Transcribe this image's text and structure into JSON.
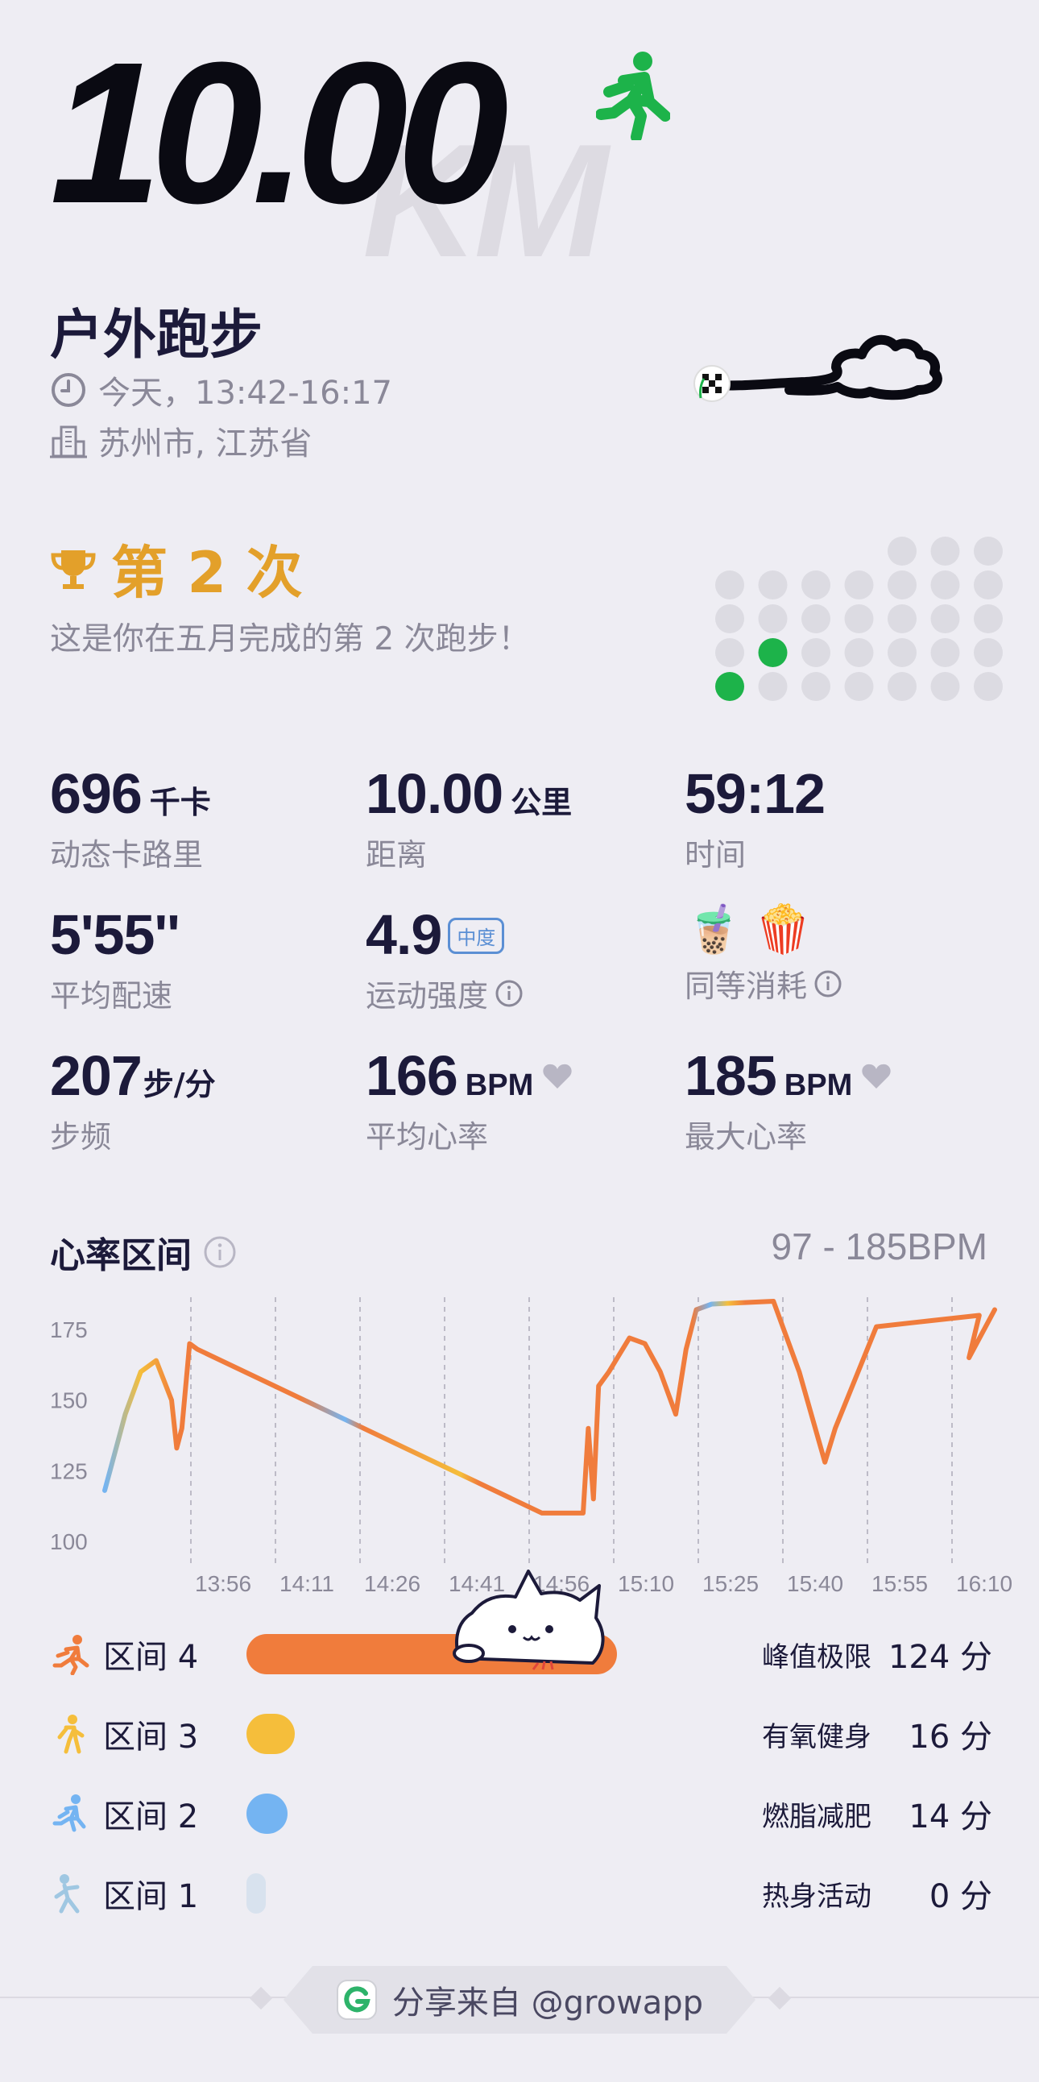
{
  "hero": {
    "distance": "10.00",
    "unit_watermark": "KM"
  },
  "activity": {
    "title": "户外跑步",
    "time": "今天，13:42-16:17",
    "location": "苏州市, 江苏省"
  },
  "achievement": {
    "title": "第 2 次",
    "description": "这是你在五月完成的第 2 次跑步！",
    "highlight_color": "#1db34a",
    "inactive_color": "#dcdbe2"
  },
  "stats": [
    {
      "value": "696",
      "unit": "千卡",
      "label": "动态卡路里"
    },
    {
      "value": "10.00",
      "unit": "公里",
      "label": "距离"
    },
    {
      "value": "59:12",
      "unit": "",
      "label": "时间"
    },
    {
      "value": "5'55''",
      "unit": "",
      "label": "平均配速"
    },
    {
      "value": "4.9",
      "unit": "",
      "badge": "中度",
      "label": "运动强度"
    },
    {
      "value": "🧋 🍿",
      "unit": "",
      "label": "同等消耗"
    },
    {
      "value": "207",
      "unit": "步/分",
      "label": "步频"
    },
    {
      "value": "166",
      "unit": "BPM",
      "label": "平均心率"
    },
    {
      "value": "185",
      "unit": "BPM",
      "label": "最大心率"
    }
  ],
  "heart_rate": {
    "title": "心率区间",
    "range": "97 - 185BPM",
    "y_ticks": [
      "175",
      "150",
      "125",
      "100"
    ],
    "x_ticks": [
      "13:56",
      "14:11",
      "14:26",
      "14:41",
      "14:56",
      "15:10",
      "15:25",
      "15:40",
      "15:55",
      "16:10"
    ]
  },
  "chart_data": {
    "type": "line",
    "title": "心率区间",
    "xlabel": "",
    "ylabel": "",
    "y_ticks": [
      175,
      150,
      125,
      100
    ],
    "ylim": [
      98,
      185
    ],
    "x_ticks": [
      "13:56",
      "14:11",
      "14:26",
      "14:41",
      "14:56",
      "15:10",
      "15:25",
      "15:40",
      "15:55",
      "16:10"
    ],
    "x_minutes": [
      0,
      4,
      7,
      10,
      13,
      14,
      15,
      16.5,
      18,
      85,
      93,
      94,
      95,
      96,
      98,
      100,
      102,
      105,
      108,
      111,
      113,
      115,
      118,
      130,
      135,
      140,
      142,
      150,
      160,
      170,
      168,
      173
    ],
    "series": [
      {
        "values": [
          118,
          145,
          160,
          164,
          150,
          133,
          140,
          170,
          168,
          110,
          110,
          140,
          115,
          155,
          160,
          166,
          172,
          170,
          160,
          145,
          168,
          182,
          184,
          185,
          160,
          128,
          140,
          176,
          178,
          180,
          165,
          182
        ]
      }
    ],
    "grid": true
  },
  "zones": [
    {
      "name": "区间 4",
      "desc": "峰值极限",
      "minutes": "124 分",
      "color": "#f07c3c",
      "fraction": 1.0
    },
    {
      "name": "区间 3",
      "desc": "有氧健身",
      "minutes": "16 分",
      "color": "#f5be3b",
      "fraction": 0.13
    },
    {
      "name": "区间 2",
      "desc": "燃脂减肥",
      "minutes": "14 分",
      "color": "#74b4f2",
      "fraction": 0.11
    },
    {
      "name": "区间 1",
      "desc": "热身活动",
      "minutes": "0 分",
      "color": "#d8e2ee",
      "fraction": 0.05
    }
  ],
  "footer": {
    "text": "分享来自 @growapp"
  }
}
